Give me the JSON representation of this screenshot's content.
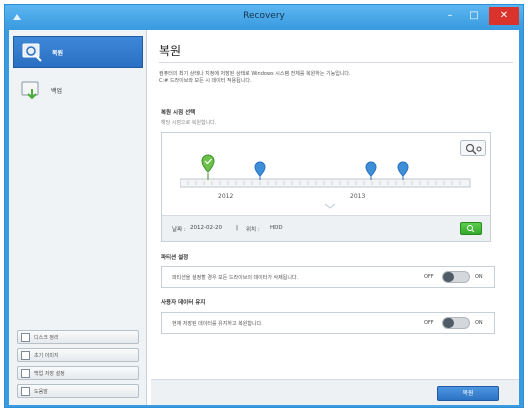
{
  "window": {
    "title": "Recovery"
  },
  "sidebar": {
    "items": [
      {
        "label": "복원",
        "icon": "restore-icon",
        "selected": true
      },
      {
        "label": "백업",
        "icon": "backup-icon",
        "selected": false
      }
    ],
    "tools": [
      {
        "label": "디스크 정리",
        "icon": "disk-cleanup-icon"
      },
      {
        "label": "초기 이미지",
        "icon": "initial-image-icon"
      },
      {
        "label": "백업 저장 설정",
        "icon": "backup-settings-icon"
      },
      {
        "label": "도움말",
        "icon": "help-icon"
      }
    ]
  },
  "main": {
    "title": "복원",
    "description_line1": "컴퓨터의 최기 상태나 지정에 저장된 상태로 Windows 시스템 전체를 복원하는 기능입니다.",
    "description_line2": "C:# 드라이브와 모든 시 데이터 적용됩니다.",
    "restore_point": {
      "title": "복원 시점 선택",
      "subtitle": "해당 시점으로 복원합니다.",
      "timeline_labels": [
        "2012",
        "2013"
      ],
      "date_label": "날짜 :",
      "date_value": "2012-02-20",
      "separator": "|",
      "location_label": "위치 :",
      "location_value": "HDD"
    },
    "partition": {
      "title": "파티션 설정",
      "text": "파티션을 설정할 경우 모든 드라이브의 데이터가 삭제됩니다.",
      "off_label": "OFF",
      "on_label": "ON"
    },
    "user_data": {
      "title": "사용자 데이터 유지",
      "text": "현재 저장된 데이터를 유지하고 복원합니다.",
      "off_label": "OFF",
      "on_label": "ON"
    },
    "restore_button": "복원"
  },
  "colors": {
    "accent": "#3a9be0",
    "selected_nav": "#2a6fc2",
    "marker_green": "#6cc14a",
    "marker_blue": "#3d8fd8",
    "close_red": "#d9332b"
  }
}
